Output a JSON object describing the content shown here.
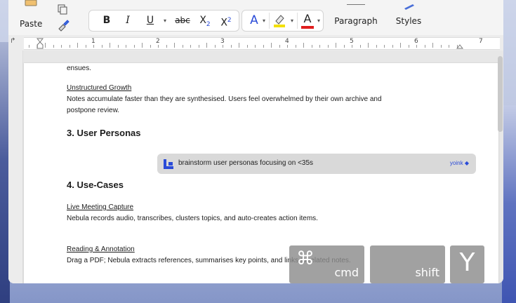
{
  "toolbar": {
    "paste_label": "Paste",
    "paragraph_label": "Paragraph",
    "styles_label": "Styles",
    "format_buttons": {
      "bold": "B",
      "italic": "I",
      "underline": "U",
      "strikethrough": "abc",
      "subscript_base": "X",
      "subscript_mark": "2",
      "superscript_base": "X",
      "superscript_mark": "2"
    },
    "text_effects_glyph": "A",
    "font_color_glyph": "A",
    "highlight_color": "#f3e000",
    "font_color": "#e01e1e"
  },
  "ruler": {
    "numbers": [
      "1",
      "2",
      "3",
      "4",
      "5",
      "6",
      "7"
    ]
  },
  "document": {
    "line_ensues": "ensues.",
    "unstructured_title": "Unstructured Growth",
    "unstructured_line1": "Notes accumulate faster than they are synthesised. Users feel overwhelmed by their own archive and",
    "unstructured_line2": "postpone review.",
    "heading_personas": "3. User Personas",
    "heading_usecases": "4. Use-Cases",
    "live_title": "Live Meeting Capture",
    "live_body": "Nebula records audio, transcribes, clusters topics, and auto-creates action items.",
    "reading_title": "Reading & Annotation",
    "reading_body": "Drag a PDF; Nebula extracts references, summarises key points, and links to related notes."
  },
  "ai_prompt": {
    "text": "brainstorm user personas focusing on <35s",
    "brand": "yoink"
  },
  "key_overlay": {
    "cmd_glyph": "⌘",
    "cmd_label": "cmd",
    "shift_label": "shift",
    "y_label": "Y"
  },
  "colors": {
    "accent": "#2a4bd8",
    "key_overlay": "#8c8c8c"
  }
}
